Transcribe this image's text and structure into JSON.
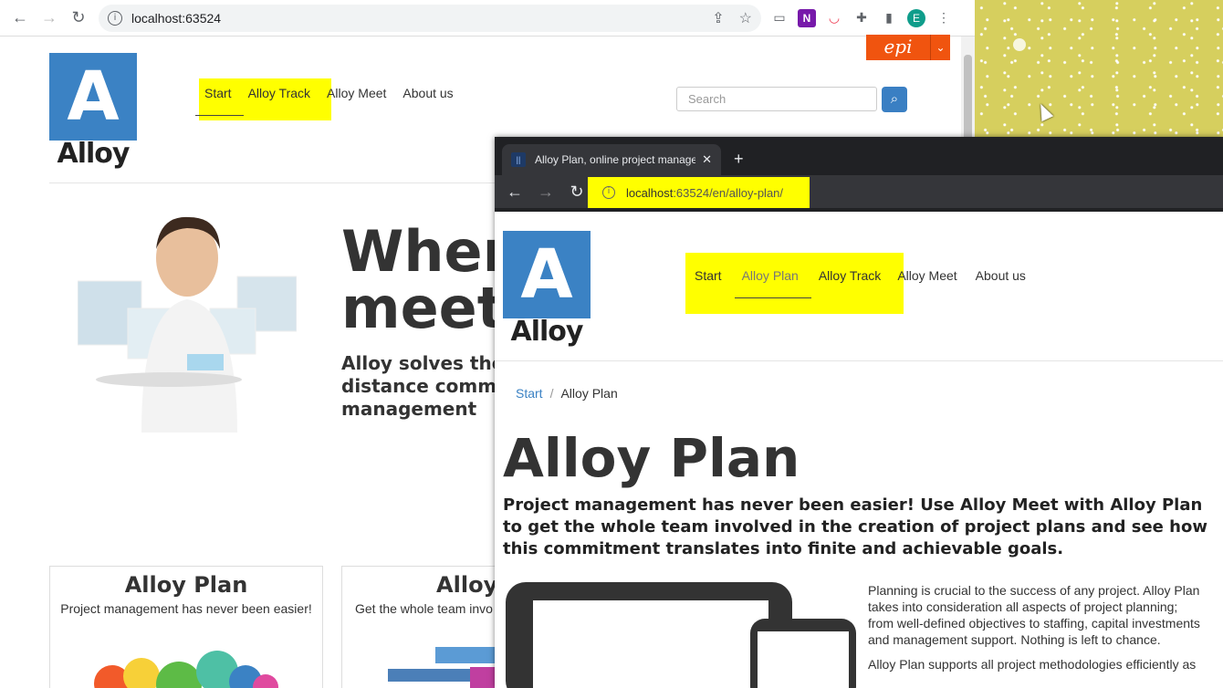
{
  "back_window": {
    "address": "localhost:63524",
    "extensions": [
      "cast-icon",
      "onenote-icon",
      "pocket-icon",
      "puzzle-icon",
      "sidepanel-icon"
    ],
    "avatar_letter": "E",
    "epi_logo": "epi",
    "logo_letter": "A",
    "logo_word": "Alloy",
    "nav": [
      "Start",
      "Alloy Track",
      "Alloy Meet",
      "About us"
    ],
    "search_placeholder": "Search",
    "hero_heading_1": "Wher",
    "hero_heading_2": "meet",
    "hero_text": "Alloy solves the in long distance communication management",
    "cards": [
      {
        "title": "Alloy Plan",
        "text": "Project management has never been easier!"
      },
      {
        "title": "Alloy T",
        "text": "Get the whole team invo"
      }
    ]
  },
  "front_window": {
    "tab_title": "Alloy Plan, online project managе",
    "address_host": "localhost",
    "address_rest": ":63524/en/alloy-plan/",
    "logo_letter": "A",
    "logo_word": "Alloy",
    "nav": [
      "Start",
      "Alloy Plan",
      "Alloy Track",
      "Alloy Meet",
      "About us"
    ],
    "breadcrumb": {
      "home": "Start",
      "current": "Alloy Plan"
    },
    "heading": "Alloy Plan",
    "lead": "Project management has never been easier! Use Alloy Meet with Alloy Plan to get the whole team involved in the creation of project plans and see how this commitment translates into finite and achievable goals.",
    "body": [
      "Planning is crucial to the success of any project. Alloy Plan takes into consideration all aspects of project planning; from well-defined objectives to staffing, capital investments and management support. Nothing is left to chance.",
      "Alloy Plan supports all project methodologies efficiently as"
    ]
  },
  "colors": {
    "brand": "#3b82c4",
    "highlight": "#ffff00",
    "epi": "#f0540f"
  }
}
